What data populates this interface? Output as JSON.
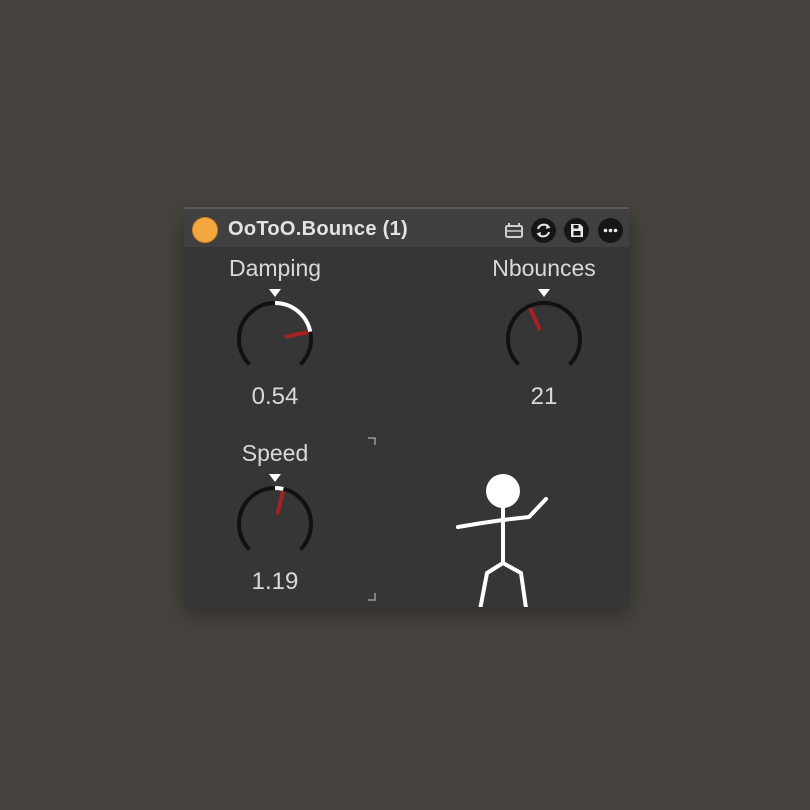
{
  "device": {
    "title": "OoToO.Bounce (1)",
    "accent_color": "#f4a63f",
    "power_state": "on"
  },
  "titlebar_icons": [
    "device-slot-icon",
    "refresh-icon",
    "save-icon",
    "more-icon"
  ],
  "controls": [
    {
      "id": "damping",
      "label": "Damping",
      "value": "0.54",
      "normalized": 0.79
    },
    {
      "id": "nbounces",
      "label": "Nbounces",
      "value": "21",
      "normalized": 0.41
    },
    {
      "id": "speed",
      "label": "Speed",
      "value": "1.19",
      "normalized": 0.55
    }
  ],
  "colors": {
    "knob_track": "#111111",
    "knob_fill": "#ffffff",
    "knob_needle": "#a52222",
    "text": "#d9d9d9"
  }
}
